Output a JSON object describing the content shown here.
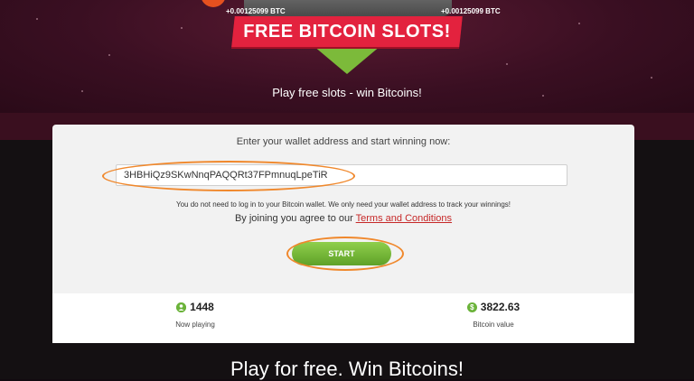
{
  "hero": {
    "banner_text": "FREE BITCOIN SLOTS!",
    "btc_amount_left": "+0.00125099 BTC",
    "btc_amount_right": "+0.00125099 BTC",
    "tagline": "Play free slots - win Bitcoins!"
  },
  "form": {
    "title": "Enter your wallet address and start winning now:",
    "wallet_value": "3HBHiQz9SKwNnqPAQQRt37FPmnuqLpeTiR",
    "note": "You do not need to log in to your Bitcoin wallet. We only need your wallet address to track your winnings!",
    "agree_text": "By joining you agree to our ",
    "terms_link": "Terms and Conditions",
    "start_label": "START"
  },
  "stats": {
    "players_value": "1448",
    "players_label": "Now playing",
    "players_icon": "user-icon",
    "bitcoin_value": "3822.63",
    "bitcoin_label": "Bitcoin value",
    "bitcoin_icon": "dollar-icon"
  },
  "footer": {
    "heading": "Play for free. Win Bitcoins!"
  },
  "colors": {
    "banner": "#e3223e",
    "accent_green": "#6bb33a",
    "highlight_orange": "#f0882c",
    "link_red": "#c62828"
  }
}
